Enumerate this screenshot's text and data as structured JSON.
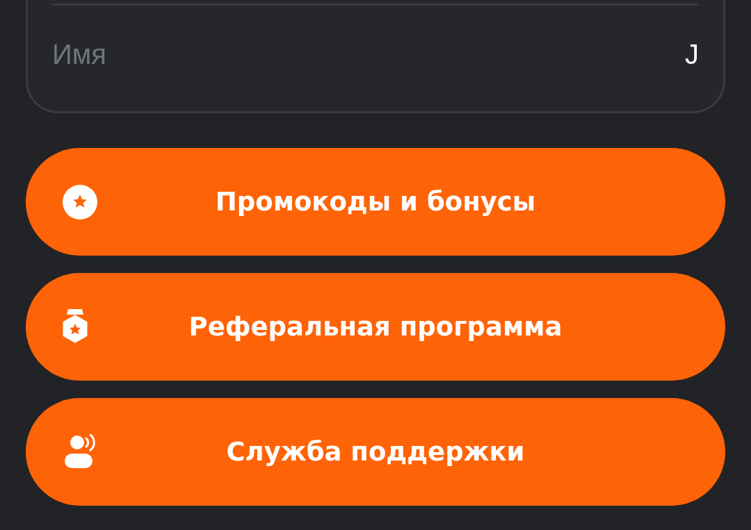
{
  "profile_field": {
    "label": "Имя",
    "value": "J"
  },
  "menu_buttons": [
    {
      "kind": "promo",
      "label": "Промокоды и бонусы"
    },
    {
      "kind": "referral",
      "label": "Реферальная программа"
    },
    {
      "kind": "support",
      "label": "Служба поддержки"
    }
  ]
}
